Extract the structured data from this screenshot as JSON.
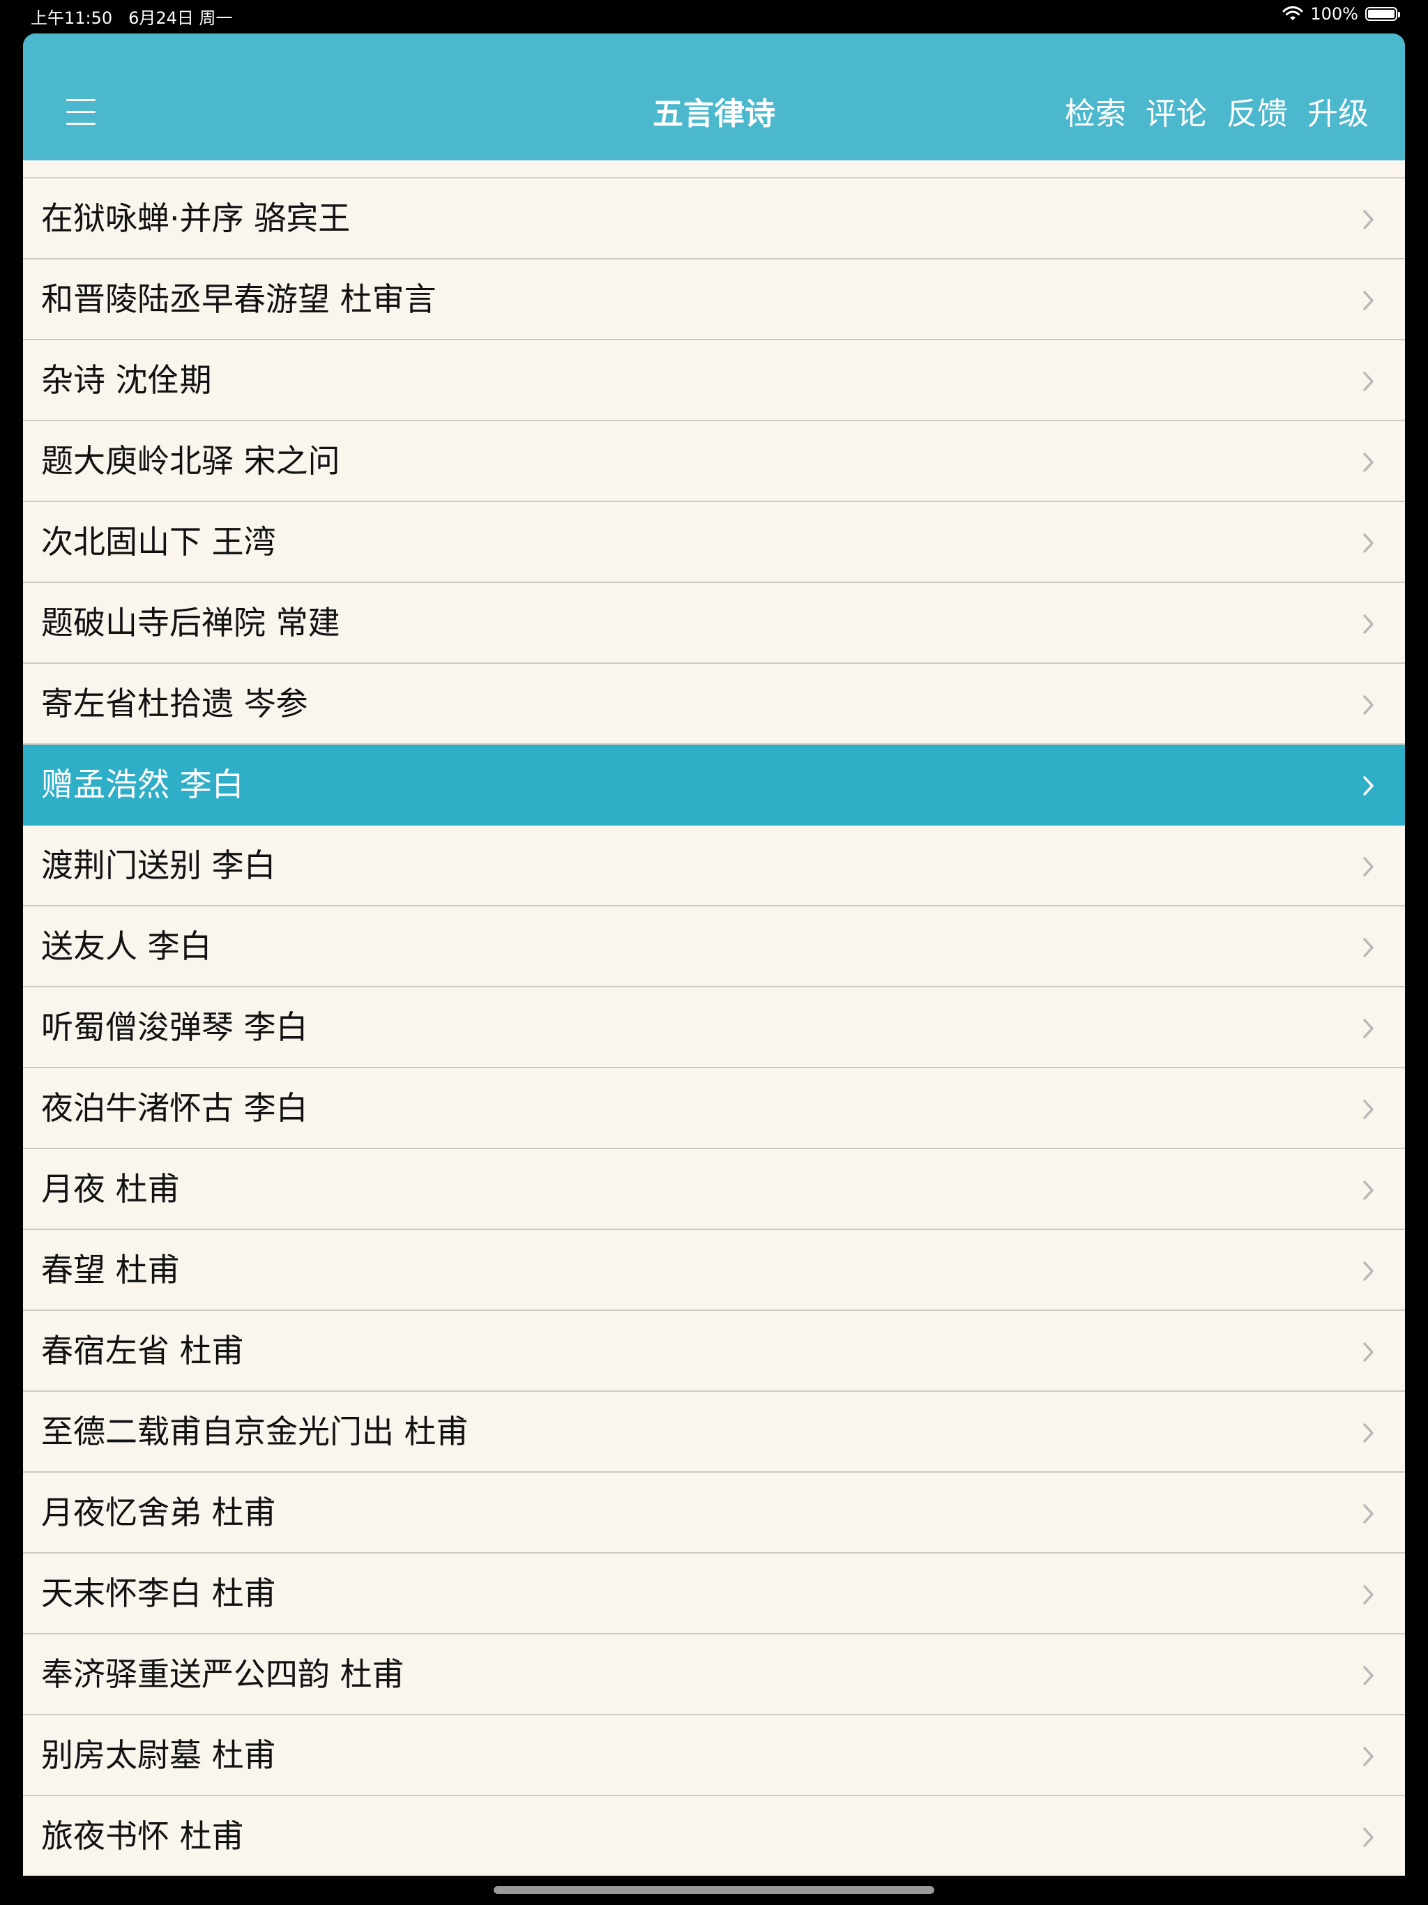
{
  "status_bar": {
    "time": "上午11:50",
    "date": "6月24日 周一",
    "battery": "100%",
    "battery_level": 1.0
  },
  "nav": {
    "title": "五言律诗",
    "actions": [
      "检索",
      "评论",
      "反馈",
      "升级"
    ]
  },
  "list": {
    "items": [
      {
        "label": "在狱咏蝉·并序 骆宾王",
        "selected": false
      },
      {
        "label": "和晋陵陆丞早春游望 杜审言",
        "selected": false
      },
      {
        "label": "杂诗 沈佺期",
        "selected": false
      },
      {
        "label": "题大庾岭北驿 宋之问",
        "selected": false
      },
      {
        "label": "次北固山下 王湾",
        "selected": false
      },
      {
        "label": "题破山寺后禅院 常建",
        "selected": false
      },
      {
        "label": "寄左省杜拾遗 岑参",
        "selected": false
      },
      {
        "label": "赠孟浩然 李白",
        "selected": true
      },
      {
        "label": "渡荆门送别 李白",
        "selected": false
      },
      {
        "label": "送友人 李白",
        "selected": false
      },
      {
        "label": "听蜀僧浚弹琴 李白",
        "selected": false
      },
      {
        "label": "夜泊牛渚怀古 李白",
        "selected": false
      },
      {
        "label": "月夜 杜甫",
        "selected": false
      },
      {
        "label": "春望 杜甫",
        "selected": false
      },
      {
        "label": "春宿左省 杜甫",
        "selected": false
      },
      {
        "label": "至德二载甫自京金光门出 杜甫",
        "selected": false
      },
      {
        "label": "月夜忆舍弟 杜甫",
        "selected": false
      },
      {
        "label": "天末怀李白 杜甫",
        "selected": false
      },
      {
        "label": "奉济驿重送严公四韵 杜甫",
        "selected": false
      },
      {
        "label": "别房太尉墓 杜甫",
        "selected": false
      },
      {
        "label": "旅夜书怀 杜甫",
        "selected": false
      }
    ]
  },
  "colors": {
    "nav_bg": "#4cb8cd",
    "selected_bg": "#2eaec7",
    "list_bg": "#faf6ee",
    "separator": "#cfcbc3"
  }
}
